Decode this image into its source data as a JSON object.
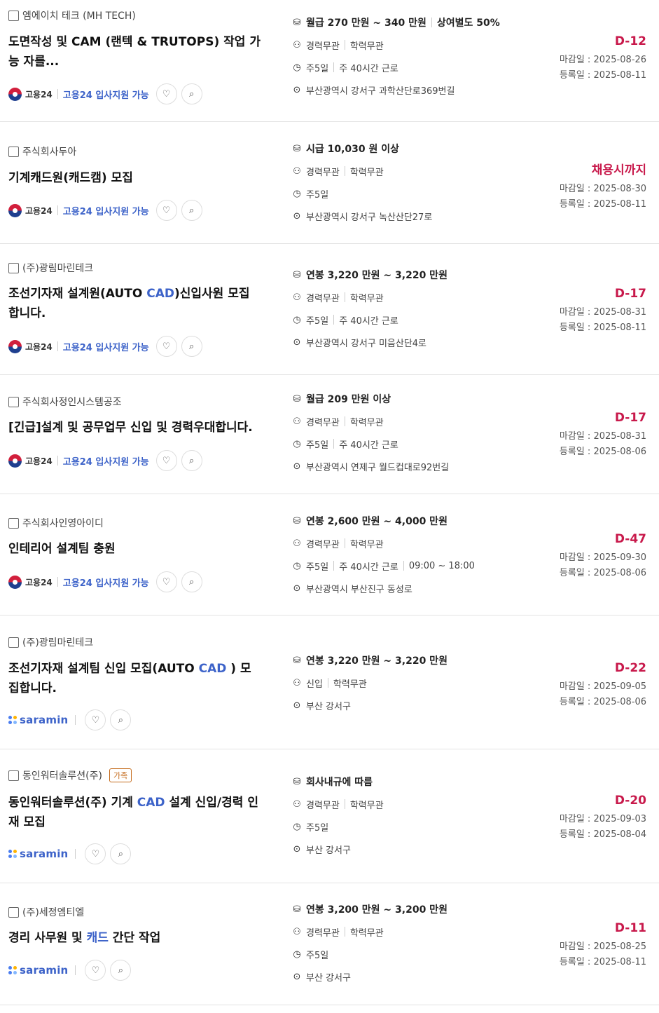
{
  "source_labels": {
    "goyong": "고용24",
    "support": "고용24 입사지원 가능",
    "saramin": "saramin"
  },
  "labels": {
    "deadline_prefix": "마감일 : ",
    "registered_prefix": "등록일 : "
  },
  "jobs": [
    {
      "company": "엠에이치 테크 (MH TECH)",
      "title": "도면작성 및 CAM (랜텍 & TRUTOPS) 작업 가능 자를...",
      "pay": "월급 270 만원 ~ 340 만원",
      "pay_extra": "상여별도 50%",
      "experience": "경력무관",
      "education": "학력무관",
      "schedule": "주5일",
      "schedule_extra": "주 40시간 근로",
      "location": "부산광역시 강서구 과학산단로369번길",
      "dday": "D-12",
      "deadline": "2025-08-26",
      "registered": "2025-08-11"
    },
    {
      "company": "주식회사두아",
      "title": "기계캐드원(캐드캠) 모집",
      "pay": "시급 10,030 원 이상",
      "experience": "경력무관",
      "education": "학력무관",
      "schedule": "주5일",
      "location": "부산광역시 강서구 녹산산단27로",
      "dday": "채용시까지",
      "deadline": "2025-08-30",
      "registered": "2025-08-11"
    },
    {
      "company": "(주)광림마린테크",
      "title_pre": "조선기자재 설계원(AUTO ",
      "title_hl": "CAD",
      "title_post": ")신입사원 모집합니다.",
      "pay": "연봉 3,220 만원 ~ 3,220 만원",
      "experience": "경력무관",
      "education": "학력무관",
      "schedule": "주5일",
      "schedule_extra": "주 40시간 근로",
      "location": "부산광역시 강서구 미음산단4로",
      "dday": "D-17",
      "deadline": "2025-08-31",
      "registered": "2025-08-11"
    },
    {
      "company": "주식회사정인시스템공조",
      "title": "[긴급]설계 및 공무업무 신입 및 경력우대합니다.",
      "pay": "월급 209 만원 이상",
      "experience": "경력무관",
      "education": "학력무관",
      "schedule": "주5일",
      "schedule_extra": "주 40시간 근로",
      "location": "부산광역시 연제구 월드컵대로92번길",
      "dday": "D-17",
      "deadline": "2025-08-31",
      "registered": "2025-08-06"
    },
    {
      "company": "주식회사인영아이디",
      "title": "인테리어 설계팀 충원",
      "pay": "연봉 2,600 만원 ~ 4,000 만원",
      "experience": "경력무관",
      "education": "학력무관",
      "schedule": "주5일",
      "schedule_extra": "주 40시간 근로",
      "schedule_time": "09:00 ~ 18:00",
      "location": "부산광역시 부산진구 동성로",
      "dday": "D-47",
      "deadline": "2025-09-30",
      "registered": "2025-08-06"
    },
    {
      "company": "(주)광림마린테크",
      "title_pre": "조선기자재 설계팀 신입 모집(AUTO ",
      "title_hl": "CAD",
      "title_post": " ) 모집합니다.",
      "pay": "연봉 3,220 만원 ~ 3,220 만원",
      "experience": "신입",
      "education": "학력무관",
      "location": "부산 강서구",
      "dday": "D-22",
      "deadline": "2025-09-05",
      "registered": "2025-08-06"
    },
    {
      "company": "동인워터솔루션(주)",
      "badge": "가족",
      "title_pre": "동인워터솔루션(주) 기계 ",
      "title_hl": "CAD",
      "title_post": " 설계 신입/경력 인재 모집",
      "pay": "회사내규에 따름",
      "experience": "경력무관",
      "education": "학력무관",
      "schedule": "주5일",
      "location": "부산 강서구",
      "dday": "D-20",
      "deadline": "2025-09-03",
      "registered": "2025-08-04"
    },
    {
      "company": "(주)세정엠티엘",
      "title_pre": "경리 사무원 및 ",
      "title_hl": "캐드",
      "title_post": " 간단 작업",
      "pay": "연봉 3,200 만원 ~ 3,200 만원",
      "experience": "경력무관",
      "education": "학력무관",
      "schedule": "주5일",
      "location": "부산 강서구",
      "dday": "D-11",
      "deadline": "2025-08-25",
      "registered": "2025-08-11"
    }
  ]
}
